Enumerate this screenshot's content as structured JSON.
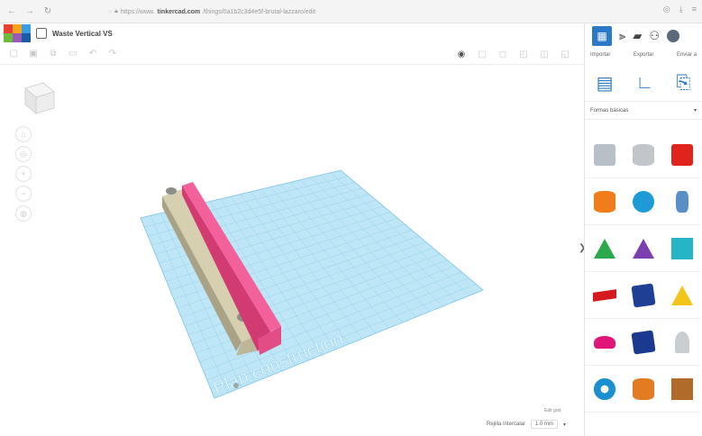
{
  "browser": {
    "url_pre": "https://www.",
    "url_domain": "tinkercad.com",
    "url_post": "/things/0a1b2c3d4e5f-brutal-lazzaro/edit"
  },
  "header": {
    "title": "Waste Vertical VS"
  },
  "right_panel": {
    "tabs": [
      "Importar",
      "Exportar",
      "Enviar a"
    ],
    "section_label": "Formas básicas",
    "shapes": [
      {
        "name": "box-holes",
        "color": "#b8bfc7"
      },
      {
        "name": "cylinder-hole",
        "color": "#c2c6cb"
      },
      {
        "name": "box",
        "color": "#e0231d"
      },
      {
        "name": "cylinder",
        "color": "#f07c1a"
      },
      {
        "name": "sphere",
        "color": "#1e9ad6"
      },
      {
        "name": "scribble",
        "color": "#5a8fc6"
      },
      {
        "name": "roof",
        "color": "#2aa84a"
      },
      {
        "name": "cone",
        "color": "#7b3fb0"
      },
      {
        "name": "round-roof",
        "color": "#25b5c7"
      },
      {
        "name": "text",
        "color": "#d5191e"
      },
      {
        "name": "polyhedron",
        "color": "#1f3f94"
      },
      {
        "name": "pyramid",
        "color": "#f3c41a"
      },
      {
        "name": "half-sphere",
        "color": "#e0157a"
      },
      {
        "name": "polygon",
        "color": "#1b3a8f"
      },
      {
        "name": "paraboloid",
        "color": "#c9ced3"
      },
      {
        "name": "torus",
        "color": "#1b8fd0"
      },
      {
        "name": "tube",
        "color": "#e27b22"
      },
      {
        "name": "wedge-hole",
        "color": "#b06a2a"
      }
    ]
  },
  "workplane": {
    "label": "Plan construction",
    "edit_grid": "Edit grid",
    "snap_label": "Rejilla Intercalar",
    "snap_value": "1.0 mm"
  },
  "colors": {
    "grid": "#9fd4ec",
    "grid_line": "#7fc3e3",
    "pink_part": "#e8457f",
    "tan_part": "#c9c2a3",
    "accent": "#2b79c9"
  }
}
